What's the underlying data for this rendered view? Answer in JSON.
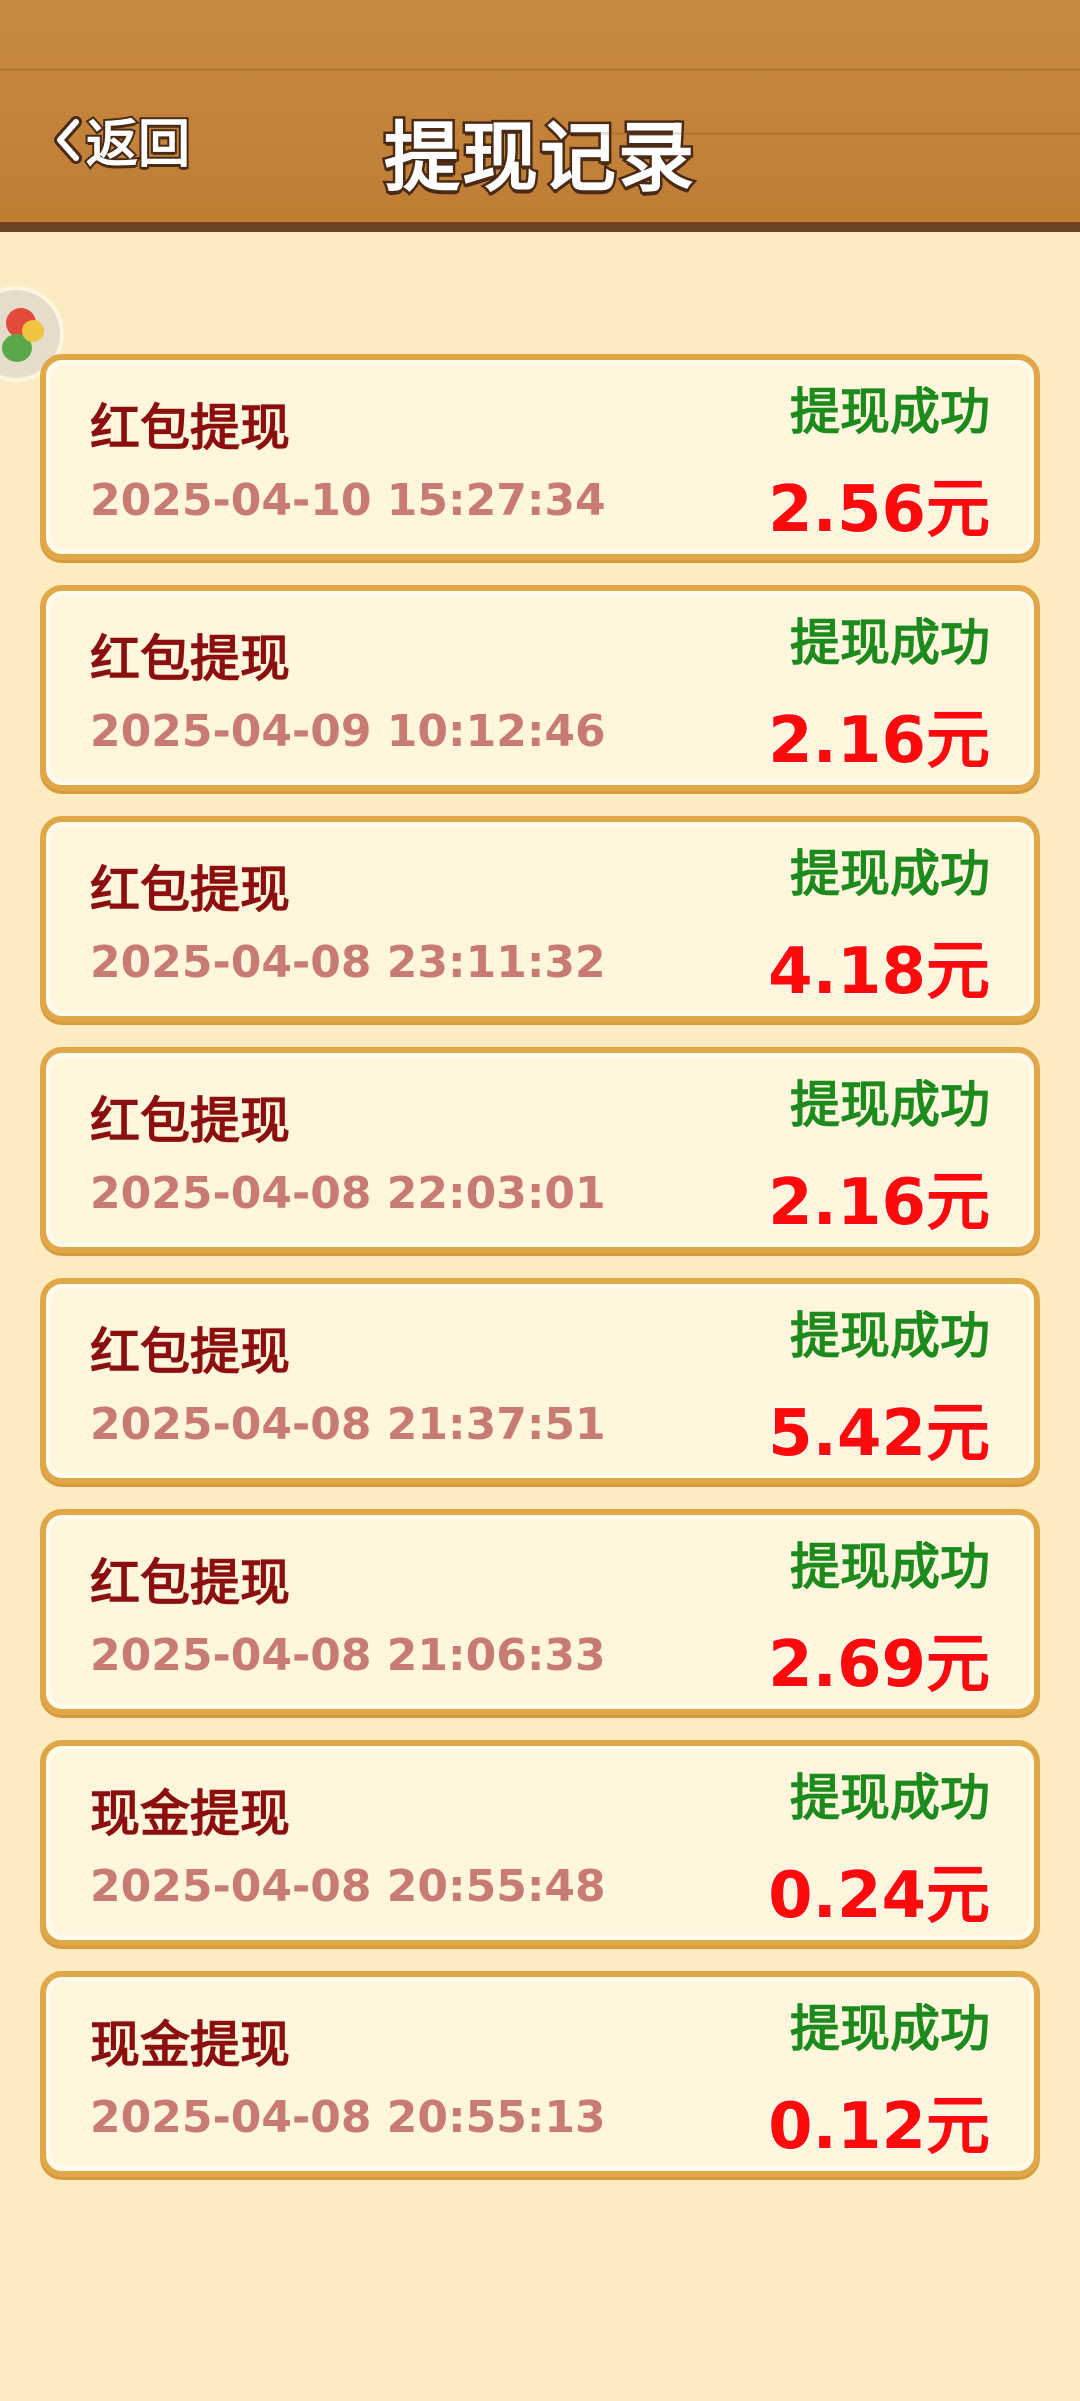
{
  "header": {
    "back_label": "返回",
    "title": "提现记录"
  },
  "records": [
    {
      "type": "红包提现",
      "time": "2025-04-10 15:27:34",
      "status": "提现成功",
      "amount": "2.56元"
    },
    {
      "type": "红包提现",
      "time": "2025-04-09 10:12:46",
      "status": "提现成功",
      "amount": "2.16元"
    },
    {
      "type": "红包提现",
      "time": "2025-04-08 23:11:32",
      "status": "提现成功",
      "amount": "4.18元"
    },
    {
      "type": "红包提现",
      "time": "2025-04-08 22:03:01",
      "status": "提现成功",
      "amount": "2.16元"
    },
    {
      "type": "红包提现",
      "time": "2025-04-08 21:37:51",
      "status": "提现成功",
      "amount": "5.42元"
    },
    {
      "type": "红包提现",
      "time": "2025-04-08 21:06:33",
      "status": "提现成功",
      "amount": "2.69元"
    },
    {
      "type": "现金提现",
      "time": "2025-04-08 20:55:48",
      "status": "提现成功",
      "amount": "0.24元"
    },
    {
      "type": "现金提现",
      "time": "2025-04-08 20:55:13",
      "status": "提现成功",
      "amount": "0.12元"
    }
  ],
  "colors": {
    "header_bg": "#c4833b",
    "page_bg": "#fdecc1",
    "status_success": "#1d8a1d",
    "amount": "#ff0a0a",
    "type_text": "#8c0f0f"
  },
  "icons": {
    "back": "chevron-left-icon",
    "floating": "floating-ball-icon"
  }
}
